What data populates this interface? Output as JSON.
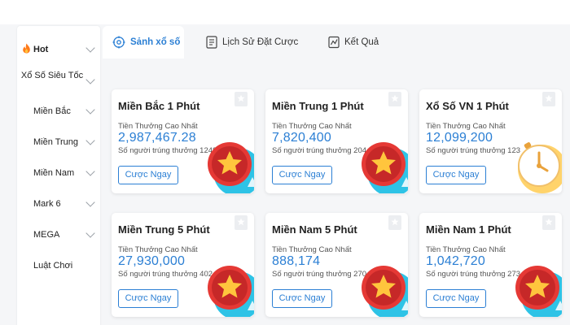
{
  "sidebar": {
    "items": [
      {
        "label": "Hot"
      },
      {
        "label": "Xổ Số Siêu Tốc"
      },
      {
        "label": "Miền Bắc"
      },
      {
        "label": "Miền Trung"
      },
      {
        "label": "Miền Nam"
      },
      {
        "label": "Mark 6"
      },
      {
        "label": "MEGA"
      },
      {
        "label": "Luật Chơi"
      }
    ]
  },
  "tabs": [
    {
      "label": "Sảnh xổ số",
      "icon": "target-icon",
      "active": true
    },
    {
      "label": "Lịch Sử Đặt Cược",
      "icon": "document-icon",
      "active": false
    },
    {
      "label": "Kết Quả",
      "icon": "chart-icon",
      "active": false
    }
  ],
  "cards": [
    {
      "title": "Miền Bắc 1 Phút",
      "prize_label": "Tiền Thưởng Cao Nhất",
      "amount": "2,987,467.28",
      "winners": "Số người trúng thưởng 1248",
      "button": "Cược Ngay",
      "art": "star-badge-icon"
    },
    {
      "title": "Miền Trung 1 Phút",
      "prize_label": "Tiền Thưởng Cao Nhất",
      "amount": "7,820,400",
      "winners": "Số người trúng thưởng 204",
      "button": "Cược Ngay",
      "art": "star-badge-icon"
    },
    {
      "title": "Xổ Số VN 1 Phút",
      "prize_label": "Tiền Thưởng Cao Nhất",
      "amount": "12,099,200",
      "winners": "Số người trúng thưởng 123",
      "button": "Cược Ngay",
      "art": "clock-icon"
    },
    {
      "title": "Miền Trung 5 Phút",
      "prize_label": "Tiền Thưởng Cao Nhất",
      "amount": "27,930,000",
      "winners": "Số người trúng thưởng 402",
      "button": "Cược Ngay",
      "art": "star-badge-icon"
    },
    {
      "title": "Miền Nam 5 Phút",
      "prize_label": "Tiền Thưởng Cao Nhất",
      "amount": "888,174",
      "winners": "Số người trúng thưởng 270",
      "button": "Cược Ngay",
      "art": "star-badge-icon"
    },
    {
      "title": "Miền Nam 1 Phút",
      "prize_label": "Tiền Thưởng Cao Nhất",
      "amount": "1,042,720",
      "winners": "Số người trúng thưởng 273",
      "button": "Cược Ngay",
      "art": "star-badge-icon"
    }
  ],
  "colors": {
    "accent": "#2b7fd4",
    "star_red": "#e53935",
    "star_gold": "#ffc53d"
  }
}
